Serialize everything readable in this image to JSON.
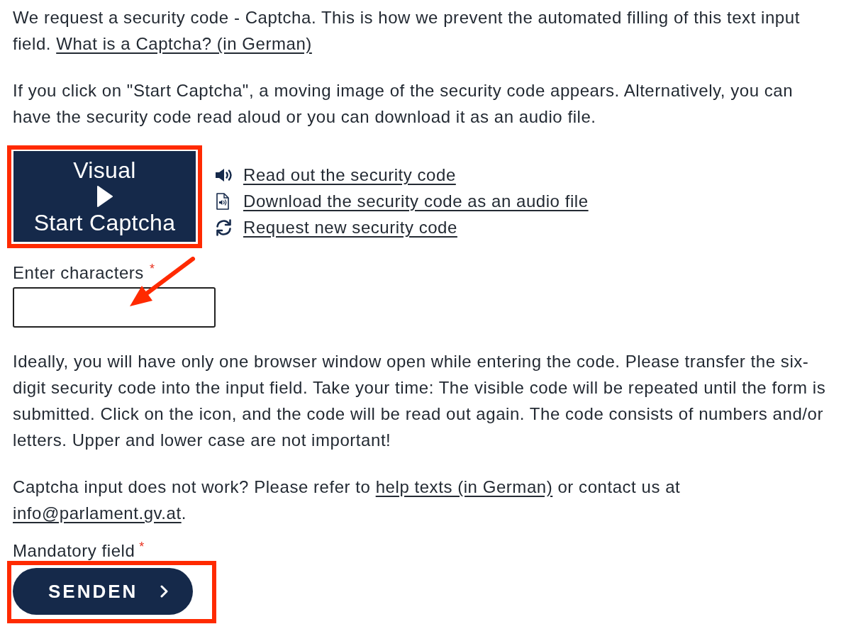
{
  "intro": {
    "text": "We request a security code - Captcha. This is how we prevent the automated filling of this text input field.",
    "link": "What is a Captcha? (in German)"
  },
  "explanation": "If you click on \"Start Captcha\", a moving image of the security code appears. Alternatively, you can have the security code read aloud or you can download it as an audio file.",
  "captcha_button": {
    "line_1": "Visual",
    "line_2": "Start Captcha"
  },
  "audio_links": [
    {
      "kind": "speaker",
      "label": "Read out the security code"
    },
    {
      "kind": "audio-file",
      "label": "Download the security code as an audio file"
    },
    {
      "kind": "refresh",
      "label": "Request new security code"
    }
  ],
  "code_input": {
    "label": "Enter characters",
    "required_mark": "*"
  },
  "hint": "Ideally, you will have only one browser window open while entering the code. Please transfer the six-digit security code into the input field. Take your time: The visible code will be repeated until the form is submitted. Click on the icon, and the code will be read out again. The code consists of numbers and/or letters. Upper and lower case are not important!",
  "help": {
    "text_before": "Captcha input does not work? Please refer to",
    "help_link": "help texts (in German)",
    "text_middle": "or contact us at",
    "email_link": "info@parlament.gv.at",
    "text_after": "."
  },
  "mandatory_note": {
    "label": "Mandatory field",
    "required_mark": "*"
  },
  "submit_button": {
    "label": "SENDEN"
  }
}
